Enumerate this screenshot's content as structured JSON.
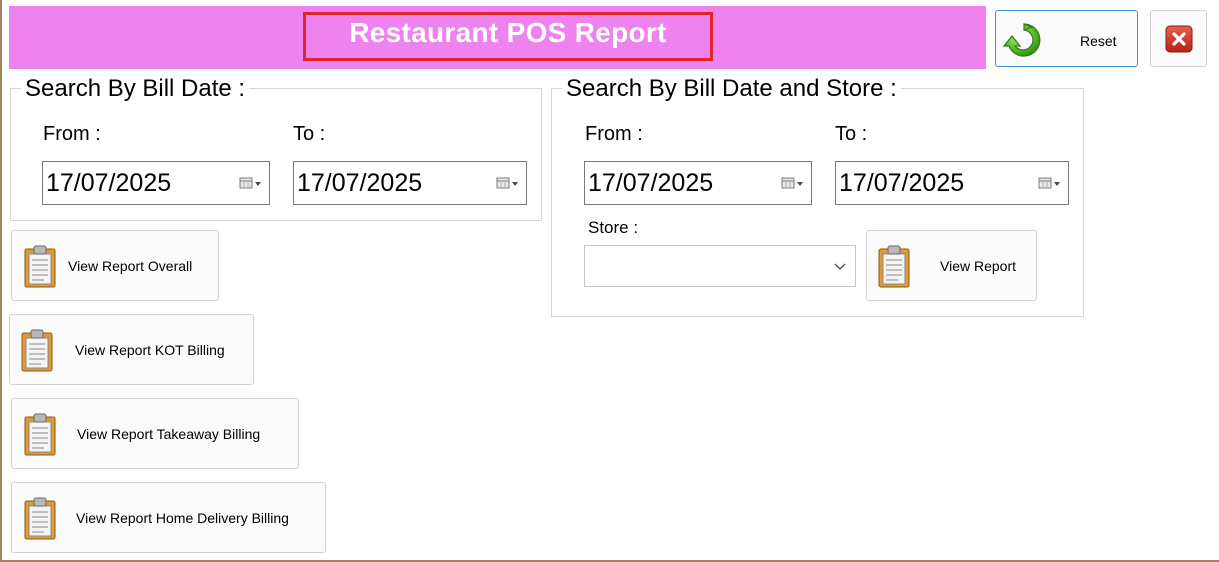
{
  "header": {
    "title": "Restaurant POS Report",
    "reset_label": "Reset"
  },
  "colors": {
    "header_background": "#EE82EE",
    "title_highlight_border": "#E0242C",
    "reset_border": "#3D8ED6",
    "close_button": "#C8302A",
    "reset_icon": "#4CAF2A"
  },
  "bill_date_group": {
    "legend": "Search By Bill Date :",
    "from_label": "From :",
    "from_value": "17/07/2025",
    "to_label": "To :",
    "to_value": "17/07/2025"
  },
  "store_group": {
    "legend": "Search By Bill Date and Store :",
    "from_label": "From :",
    "from_value": "17/07/2025",
    "to_label": "To :",
    "to_value": "17/07/2025",
    "store_label": "Store :",
    "store_value": "",
    "view_report_label": "View Report"
  },
  "report_buttons": [
    {
      "label": "View Report Overall",
      "icon": "clipboard-icon"
    },
    {
      "label": "View Report KOT Billing",
      "icon": "clipboard-icon"
    },
    {
      "label": "View Report Takeaway Billing",
      "icon": "clipboard-icon"
    },
    {
      "label": "View Report Home Delivery Billing",
      "icon": "clipboard-icon"
    }
  ],
  "icons": {
    "reset": "refresh-icon",
    "close": "close-icon",
    "calendar": "calendar-dropdown-icon",
    "store_dropdown": "chevron-down-icon"
  }
}
